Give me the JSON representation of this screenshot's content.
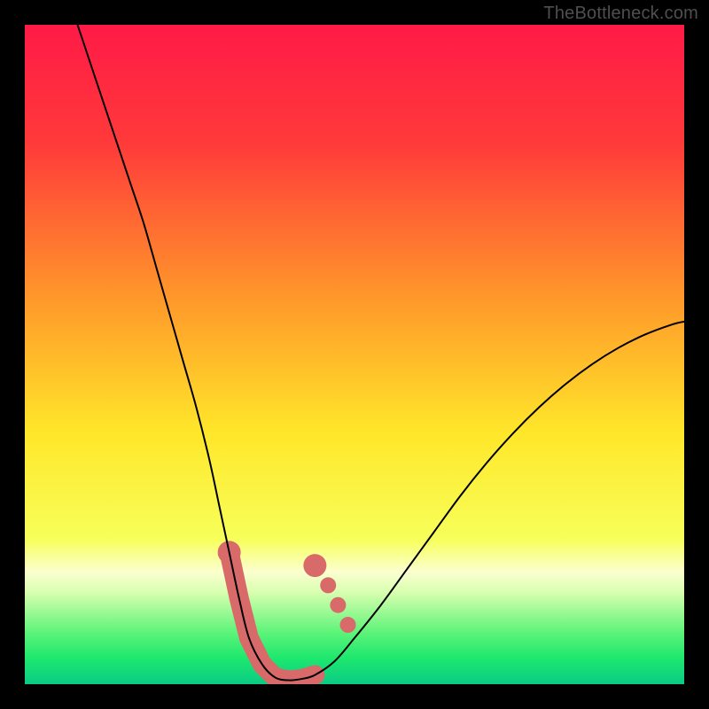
{
  "watermark": "TheBottleneck.com",
  "chart_data": {
    "type": "line",
    "title": "",
    "xlabel": "",
    "ylabel": "",
    "xlim": [
      0,
      100
    ],
    "ylim": [
      0,
      100
    ],
    "gradient_stops": [
      {
        "offset": 0,
        "color": "#ff1a47"
      },
      {
        "offset": 18,
        "color": "#ff3a3a"
      },
      {
        "offset": 42,
        "color": "#ff9a2a"
      },
      {
        "offset": 62,
        "color": "#ffe72a"
      },
      {
        "offset": 78,
        "color": "#f7ff5a"
      },
      {
        "offset": 83,
        "color": "#fbffd0"
      },
      {
        "offset": 86,
        "color": "#d9ffb0"
      },
      {
        "offset": 92,
        "color": "#60f47a"
      },
      {
        "offset": 96,
        "color": "#1ee86e"
      },
      {
        "offset": 100,
        "color": "#0acc84"
      }
    ],
    "series": [
      {
        "name": "bottleneck-curve",
        "x": [
          8,
          10,
          12,
          14,
          16,
          18,
          20,
          22,
          24,
          26,
          28,
          29.5,
          31,
          32.5,
          34,
          36,
          38,
          40,
          42,
          44,
          47,
          50,
          54,
          58,
          62,
          66,
          70,
          74,
          78,
          82,
          86,
          90,
          94,
          98,
          100
        ],
        "y": [
          100,
          94,
          88,
          82,
          76,
          70,
          63,
          56,
          49,
          42,
          34,
          27,
          20,
          13,
          7,
          3,
          1,
          0.6,
          0.8,
          1.4,
          3.5,
          7,
          12,
          17.5,
          23,
          28.5,
          33.5,
          38,
          42,
          45.5,
          48.5,
          51,
          53,
          54.5,
          55
        ]
      }
    ],
    "markers": {
      "name": "highlight-band",
      "color": "#d86a6a",
      "band_x": [
        31,
        44
      ],
      "points": [
        {
          "x": 31,
          "y": 20
        },
        {
          "x": 44,
          "y": 18
        }
      ],
      "dots": [
        {
          "x": 46,
          "y": 15
        },
        {
          "x": 47.5,
          "y": 12
        },
        {
          "x": 49,
          "y": 9
        }
      ]
    }
  }
}
